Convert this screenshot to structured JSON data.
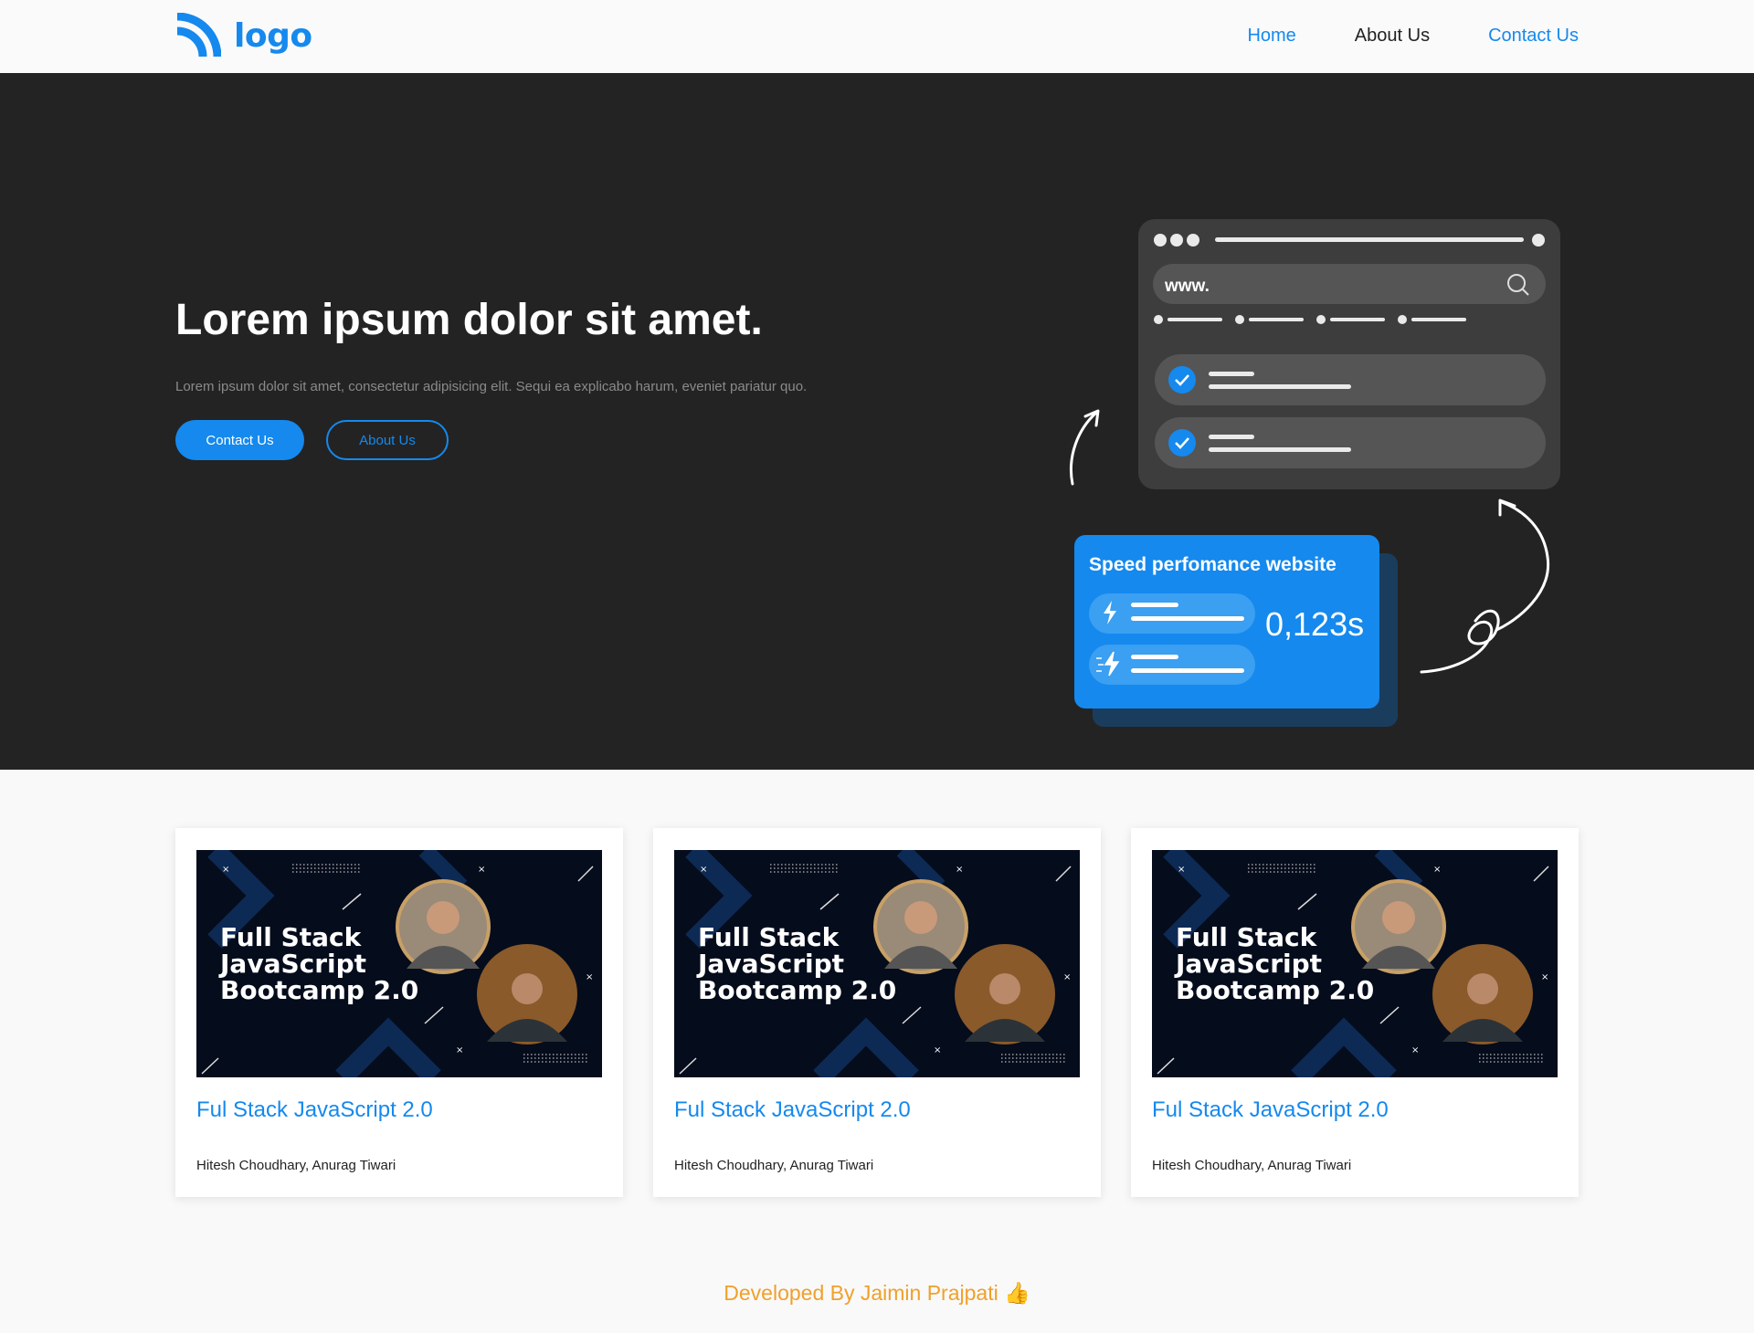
{
  "nav": {
    "logo_text": "logo",
    "links": [
      {
        "label": "Home"
      },
      {
        "label": "About Us"
      },
      {
        "label": "Contact Us"
      }
    ]
  },
  "hero": {
    "title": "Lorem ipsum dolor sit amet.",
    "subtitle": "Lorem ipsum dolor sit amet, consectetur adipisicing elit. Sequi ea explicabo harum, eveniet pariatur quo.",
    "primary_button": "Contact Us",
    "secondary_button": "About Us"
  },
  "illustration": {
    "url_text": "www.",
    "speed_title": "Speed perfomance website",
    "speed_value": "0,123s"
  },
  "courses": [
    {
      "thumb_text": [
        "Full Stack",
        "JavaScript",
        "Bootcamp 2.0"
      ],
      "title": "Ful Stack JavaScript 2.0",
      "authors": "Hitesh Choudhary, Anurag Tiwari"
    },
    {
      "thumb_text": [
        "Full Stack",
        "JavaScript",
        "Bootcamp 2.0"
      ],
      "title": "Ful Stack JavaScript 2.0",
      "authors": "Hitesh Choudhary, Anurag Tiwari"
    },
    {
      "thumb_text": [
        "Full Stack",
        "JavaScript",
        "Bootcamp 2.0"
      ],
      "title": "Ful Stack JavaScript 2.0",
      "authors": "Hitesh Choudhary, Anurag Tiwari"
    }
  ],
  "footer": {
    "text": "Developed By Jaimin Prajpati 👍"
  },
  "colors": {
    "accent": "#1589ee",
    "hero_bg": "#232323",
    "footer_text": "#f0a02a"
  }
}
